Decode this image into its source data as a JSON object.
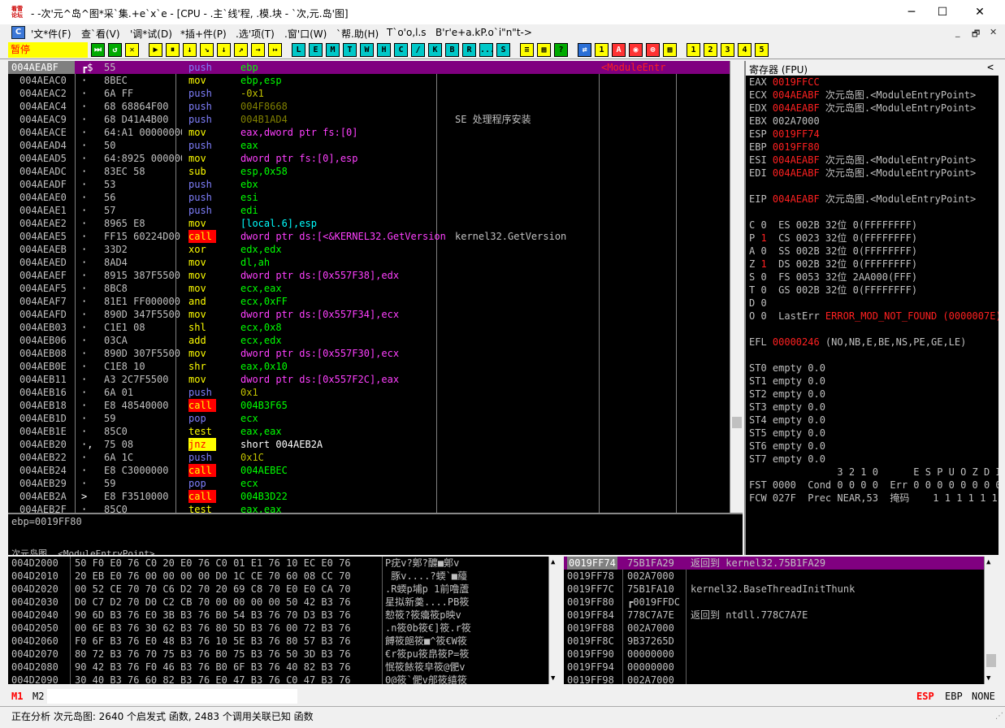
{
  "titlebar": {
    "title": "- -次'元^岛^图*采`集.+e`x`e - [CPU - .主`线'程, .模.块 - `次,元.岛'图]",
    "icon_text": "看雪\n论坛",
    "minimize": "─",
    "maximize": "☐",
    "close": "✕"
  },
  "menu": {
    "items": [
      "'文*件(F)",
      "查`看(V)",
      "'调*试(D)",
      "*插+件(P)",
      ".选'项(T)",
      ".窗'口(W)",
      "`帮.助(H)",
      "T`o'o,l.s",
      "B'r'e+a.kP.o`i\"n\"t->"
    ],
    "mdi": [
      "_",
      "🗗",
      "✕"
    ]
  },
  "toolbar": {
    "status": "暂停",
    "buttons": [
      "⏭",
      "↺",
      "✕",
      "▶",
      "⏸",
      "↓",
      "↘",
      "↓",
      "↗",
      "→",
      "↦",
      "L",
      "E",
      "M",
      "T",
      "W",
      "H",
      "C",
      "/",
      "K",
      "B",
      "R",
      "...",
      "S",
      "≡",
      "▦",
      "?",
      "⇄",
      "1",
      "A",
      "◉",
      "⊚",
      "▦",
      "1",
      "2",
      "3",
      "4",
      "5"
    ]
  },
  "disasm": {
    "rows": [
      {
        "addr": "004AEABF",
        "mark": "┏$",
        "hex": "55",
        "mn": "push",
        "op": "ebp",
        "cm": "",
        "sel": true,
        "right": "<ModuleEntr"
      },
      {
        "addr": "004AEAC0",
        "mark": "·",
        "hex": "8BEC",
        "mn": "mov",
        "op": "ebp,esp",
        "cm": ""
      },
      {
        "addr": "004AEAC2",
        "mark": "·",
        "hex": "6A FF",
        "mn": "push",
        "op": "-0x1",
        "cm": ""
      },
      {
        "addr": "004AEAC4",
        "mark": "·",
        "hex": "68 68864F00",
        "mn": "push",
        "op": "004F8668",
        "cm": ""
      },
      {
        "addr": "004AEAC9",
        "mark": "·",
        "hex": "68 D41A4B00",
        "mn": "push",
        "op": "004B1AD4",
        "cm": "SE 处理程序安装"
      },
      {
        "addr": "004AEACE",
        "mark": "·",
        "hex": "64:A1 00000000",
        "mn": "mov",
        "op": "eax,dword ptr fs:[0]",
        "cm": ""
      },
      {
        "addr": "004AEAD4",
        "mark": "·",
        "hex": "50",
        "mn": "push",
        "op": "eax",
        "cm": ""
      },
      {
        "addr": "004AEAD5",
        "mark": "·",
        "hex": "64:8925 00000000",
        "mn": "mov",
        "op": "dword ptr fs:[0],esp",
        "cm": ""
      },
      {
        "addr": "004AEADC",
        "mark": "·",
        "hex": "83EC 58",
        "mn": "sub",
        "op": "esp,0x58",
        "cm": ""
      },
      {
        "addr": "004AEADF",
        "mark": "·",
        "hex": "53",
        "mn": "push",
        "op": "ebx",
        "cm": ""
      },
      {
        "addr": "004AEAE0",
        "mark": "·",
        "hex": "56",
        "mn": "push",
        "op": "esi",
        "cm": ""
      },
      {
        "addr": "004AEAE1",
        "mark": "·",
        "hex": "57",
        "mn": "push",
        "op": "edi",
        "cm": ""
      },
      {
        "addr": "004AEAE2",
        "mark": "·",
        "hex": "8965 E8",
        "mn": "mov",
        "op": "[local.6],esp",
        "cm": ""
      },
      {
        "addr": "004AEAE5",
        "mark": "·",
        "hex": "FF15 60224D00",
        "mn": "call",
        "op": "dword ptr ds:[<&KERNEL32.GetVersion>]",
        "cm": "kernel32.GetVersion"
      },
      {
        "addr": "004AEAEB",
        "mark": "·",
        "hex": "33D2",
        "mn": "xor",
        "op": "edx,edx",
        "cm": ""
      },
      {
        "addr": "004AEAED",
        "mark": "·",
        "hex": "8AD4",
        "mn": "mov",
        "op": "dl,ah",
        "cm": ""
      },
      {
        "addr": "004AEAEF",
        "mark": "·",
        "hex": "8915 387F5500",
        "mn": "mov",
        "op": "dword ptr ds:[0x557F38],edx",
        "cm": ""
      },
      {
        "addr": "004AEAF5",
        "mark": "·",
        "hex": "8BC8",
        "mn": "mov",
        "op": "ecx,eax",
        "cm": ""
      },
      {
        "addr": "004AEAF7",
        "mark": "·",
        "hex": "81E1 FF000000",
        "mn": "and",
        "op": "ecx,0xFF",
        "cm": ""
      },
      {
        "addr": "004AEAFD",
        "mark": "·",
        "hex": "890D 347F5500",
        "mn": "mov",
        "op": "dword ptr ds:[0x557F34],ecx",
        "cm": ""
      },
      {
        "addr": "004AEB03",
        "mark": "·",
        "hex": "C1E1 08",
        "mn": "shl",
        "op": "ecx,0x8",
        "cm": ""
      },
      {
        "addr": "004AEB06",
        "mark": "·",
        "hex": "03CA",
        "mn": "add",
        "op": "ecx,edx",
        "cm": ""
      },
      {
        "addr": "004AEB08",
        "mark": "·",
        "hex": "890D 307F5500",
        "mn": "mov",
        "op": "dword ptr ds:[0x557F30],ecx",
        "cm": ""
      },
      {
        "addr": "004AEB0E",
        "mark": "·",
        "hex": "C1E8 10",
        "mn": "shr",
        "op": "eax,0x10",
        "cm": ""
      },
      {
        "addr": "004AEB11",
        "mark": "·",
        "hex": "A3 2C7F5500",
        "mn": "mov",
        "op": "dword ptr ds:[0x557F2C],eax",
        "cm": ""
      },
      {
        "addr": "004AEB16",
        "mark": "·",
        "hex": "6A 01",
        "mn": "push",
        "op": "0x1",
        "cm": ""
      },
      {
        "addr": "004AEB18",
        "mark": "·",
        "hex": "E8 48540000",
        "mn": "call",
        "op": "004B3F65",
        "cm": ""
      },
      {
        "addr": "004AEB1D",
        "mark": "·",
        "hex": "59",
        "mn": "pop",
        "op": "ecx",
        "cm": ""
      },
      {
        "addr": "004AEB1E",
        "mark": "·",
        "hex": "85C0",
        "mn": "test",
        "op": "eax,eax",
        "cm": ""
      },
      {
        "addr": "004AEB20",
        "mark": "·,",
        "hex": "75 08",
        "mn": "jnz",
        "op": "short 004AEB2A",
        "cm": ""
      },
      {
        "addr": "004AEB22",
        "mark": "·",
        "hex": "6A 1C",
        "mn": "push",
        "op": "0x1C",
        "cm": ""
      },
      {
        "addr": "004AEB24",
        "mark": "·",
        "hex": "E8 C3000000",
        "mn": "call",
        "op": "004AEBEC",
        "cm": ""
      },
      {
        "addr": "004AEB29",
        "mark": "·",
        "hex": "59",
        "mn": "pop",
        "op": "ecx",
        "cm": ""
      },
      {
        "addr": "004AEB2A",
        "mark": ">",
        "hex": "E8 F3510000",
        "mn": "call",
        "op": "004B3D22",
        "cm": ""
      },
      {
        "addr": "004AEB2F",
        "mark": "·",
        "hex": "85C0",
        "mn": "test",
        "op": "eax,eax",
        "cm": ""
      }
    ]
  },
  "info": {
    "line1": "ebp=0019FF80",
    "line2": "次元岛图 .<ModuleEntryPoint>"
  },
  "registers": {
    "header": "寄存器 (FPU)",
    "arrow": "<",
    "rows": [
      {
        "t": "EAX 0019FFCC",
        "hl": "0019FFCC",
        "rest": ""
      },
      {
        "t": "ECX 004AEABF",
        "hl": "004AEABF",
        "rest": " 次元岛图.<ModuleEntryPoint>"
      },
      {
        "t": "EDX 004AEABF",
        "hl": "004AEABF",
        "rest": " 次元岛图.<ModuleEntryPoint>"
      },
      {
        "t": "EBX 002A7000",
        "hl": "",
        "rest": ""
      },
      {
        "t": "ESP 0019FF74",
        "hl": "0019FF74",
        "rest": ""
      },
      {
        "t": "EBP 0019FF80",
        "hl": "0019FF80",
        "rest": ""
      },
      {
        "t": "ESI 004AEABF",
        "hl": "004AEABF",
        "rest": " 次元岛图.<ModuleEntryPoint>"
      },
      {
        "t": "EDI 004AEABF",
        "hl": "004AEABF",
        "rest": " 次元岛图.<ModuleEntryPoint>"
      },
      {
        "t": "",
        "hl": "",
        "rest": ""
      },
      {
        "t": "EIP 004AEABF",
        "hl": "004AEABF",
        "rest": " 次元岛图.<ModuleEntryPoint>"
      },
      {
        "t": "",
        "hl": "",
        "rest": ""
      },
      {
        "t": "C 0  ES 002B 32位 0(FFFFFFFF)",
        "hl": "",
        "rest": ""
      },
      {
        "t": "P 1  CS 0023 32位 0(FFFFFFFF)",
        "hl": "1",
        "rest": ""
      },
      {
        "t": "A 0  SS 002B 32位 0(FFFFFFFF)",
        "hl": "",
        "rest": ""
      },
      {
        "t": "Z 1  DS 002B 32位 0(FFFFFFFF)",
        "hl": "1",
        "rest": ""
      },
      {
        "t": "S 0  FS 0053 32位 2AA000(FFF)",
        "hl": "",
        "rest": ""
      },
      {
        "t": "T 0  GS 002B 32位 0(FFFFFFFF)",
        "hl": "",
        "rest": ""
      },
      {
        "t": "D 0",
        "hl": "",
        "rest": ""
      },
      {
        "t": "O 0  LastErr ERROR_MOD_NOT_FOUND (0000007E)",
        "hl": "ERROR_MOD_NOT_FOUND (0000007E)",
        "rest": ""
      },
      {
        "t": "",
        "hl": "",
        "rest": ""
      },
      {
        "t": "EFL 00000246 (NO,NB,E,BE,NS,PE,GE,LE)",
        "hl": "00000246",
        "rest": ""
      },
      {
        "t": "",
        "hl": "",
        "rest": ""
      },
      {
        "t": "ST0 empty 0.0",
        "hl": "",
        "rest": ""
      },
      {
        "t": "ST1 empty 0.0",
        "hl": "",
        "rest": ""
      },
      {
        "t": "ST2 empty 0.0",
        "hl": "",
        "rest": ""
      },
      {
        "t": "ST3 empty 0.0",
        "hl": "",
        "rest": ""
      },
      {
        "t": "ST4 empty 0.0",
        "hl": "",
        "rest": ""
      },
      {
        "t": "ST5 empty 0.0",
        "hl": "",
        "rest": ""
      },
      {
        "t": "ST6 empty 0.0",
        "hl": "",
        "rest": ""
      },
      {
        "t": "ST7 empty 0.0",
        "hl": "",
        "rest": ""
      },
      {
        "t": "               3 2 1 0      E S P U O Z D I",
        "hl": "",
        "rest": ""
      },
      {
        "t": "FST 0000  Cond 0 0 0 0  Err 0 0 0 0 0 0 0 0",
        "hl": "",
        "rest": ""
      },
      {
        "t": "FCW 027F  Prec NEAR,53  掩码    1 1 1 1 1 1",
        "hl": "",
        "rest": ""
      }
    ]
  },
  "dump": {
    "rows": [
      {
        "addr": "004D2000",
        "hex": "50 F0 E0 76 C0 20 E0 76 C0 01 E1 76 10 EC E0 76",
        "asc": "P疣v?鄓?醾■鄓v"
      },
      {
        "addr": "004D2010",
        "hex": "20 EB E0 76 00 00 00 00 D0 1C CE 70 60 08 CC 70",
        "asc": " 豚v....?蝡`■蘰"
      },
      {
        "addr": "004D2020",
        "hex": "00 52 CE 70 70 C6 D2 70 20 69 C8 70 E0 E0 CA 70",
        "asc": ".R蝡p埔p 1前噜蔖"
      },
      {
        "addr": "004D2030",
        "hex": "D0 C7 D2 70 D0 C2 CB 70 00 00 00 00 50 42 B3 76",
        "asc": "星拟新羮....PB筱"
      },
      {
        "addr": "004D2040",
        "hex": "90 6D B3 76 E0 3B B3 76 B0 54 B3 76 70 D3 B3 76",
        "asc": "愸筱?筱癟筱p映v"
      },
      {
        "addr": "004D2050",
        "hex": "00 6E B3 76 30 62 B3 76 80 5D B3 76 00 72 B3 76",
        "asc": ".n筱0b筱€]筱.r筱"
      },
      {
        "addr": "004D2060",
        "hex": "F0 6F B3 76 E0 48 B3 76 10 5E B3 76 80 57 B3 76",
        "asc": "餺筱郒筱■^筱€W筱"
      },
      {
        "addr": "004D2070",
        "hex": "80 72 B3 76 70 75 B3 76 B0 75 B3 76 50 3D B3 76",
        "asc": "€r筱pu筱皍筱P=筱"
      },
      {
        "addr": "004D2080",
        "hex": "90 42 B3 76 F0 46 B3 76 B0 6F B3 76 40 82 B3 76",
        "asc": "怋筱餏筱皁筱@俷v"
      },
      {
        "addr": "004D2090",
        "hex": "30 40 B3 76 60 82 B3 76 E0 47 B3 76 C0 47 B3 76",
        "asc": "0@筱`俷v郍筱繥筱"
      }
    ]
  },
  "stack": {
    "rows": [
      {
        "addr": "0019FF74",
        "val": "75B1FA29",
        "cm": "返回到 kernel32.75B1FA29",
        "sel": true
      },
      {
        "addr": "0019FF78",
        "val": "002A7000",
        "cm": ""
      },
      {
        "addr": "0019FF7C",
        "val": "75B1FA10",
        "cm": "kernel32.BaseThreadInitThunk"
      },
      {
        "addr": "0019FF80",
        "val": "┏0019FFDC",
        "cm": ""
      },
      {
        "addr": "0019FF84",
        "val": "778C7A7E",
        "cm": "返回到 ntdll.778C7A7E"
      },
      {
        "addr": "0019FF88",
        "val": "002A7000",
        "cm": ""
      },
      {
        "addr": "0019FF8C",
        "val": "9B37265D",
        "cm": ""
      },
      {
        "addr": "0019FF90",
        "val": "00000000",
        "cm": ""
      },
      {
        "addr": "0019FF94",
        "val": "00000000",
        "cm": ""
      },
      {
        "addr": "0019FF98",
        "val": "002A7000",
        "cm": ""
      }
    ]
  },
  "cmdbar": {
    "m1": "M1",
    "m2": "M2",
    "regs": [
      "ESP",
      "EBP",
      "NONE"
    ]
  },
  "status": {
    "text": "正在分析 次元岛图: 2640 个启发式 函数, 2483 个调用关联已知 函数"
  },
  "colors": {
    "purple": "#800080",
    "push": "#8080ff",
    "mov": "#ffff00",
    "call_bg": "#ff0000",
    "green": "#00ff00",
    "cyan": "#00ffff",
    "red": "#ff0000",
    "num": "#808000"
  }
}
